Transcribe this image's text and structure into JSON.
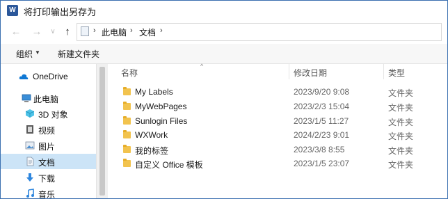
{
  "window": {
    "title": "将打印输出另存为",
    "app_icon": "word-app-icon"
  },
  "nav": {
    "back_icon": "back-arrow-icon",
    "forward_icon": "forward-arrow-icon",
    "recent_icon": "chevron-down-icon",
    "up_icon": "up-arrow-icon",
    "breadcrumb": [
      "此电脑",
      "文档"
    ],
    "breadcrumb_sep": "›"
  },
  "toolbar": {
    "organize_label": "组织",
    "new_folder_label": "新建文件夹"
  },
  "sidebar": {
    "items": [
      {
        "label": "OneDrive",
        "icon": "cloud-icon"
      },
      {
        "label": "此电脑",
        "icon": "computer-icon"
      },
      {
        "label": "3D 对象",
        "icon": "cube-icon"
      },
      {
        "label": "视频",
        "icon": "video-icon"
      },
      {
        "label": "图片",
        "icon": "picture-icon"
      },
      {
        "label": "文档",
        "icon": "document-icon",
        "selected": true
      },
      {
        "label": "下载",
        "icon": "download-icon"
      },
      {
        "label": "音乐",
        "icon": "music-icon"
      }
    ]
  },
  "columns": {
    "name": "名称",
    "modified": "修改日期",
    "type": "类型"
  },
  "files": [
    {
      "name": "My Labels",
      "modified": "2023/9/20 9:08",
      "type": "文件夹"
    },
    {
      "name": "MyWebPages",
      "modified": "2023/2/3 15:04",
      "type": "文件夹"
    },
    {
      "name": "Sunlogin Files",
      "modified": "2023/1/5 11:27",
      "type": "文件夹"
    },
    {
      "name": "WXWork",
      "modified": "2024/2/23 9:01",
      "type": "文件夹"
    },
    {
      "name": "我的标签",
      "modified": "2023/3/8 8:55",
      "type": "文件夹"
    },
    {
      "name": "自定义 Office 模板",
      "modified": "2023/1/5 23:07",
      "type": "文件夹"
    }
  ],
  "colors": {
    "selection": "#cce4f7",
    "folder": "#f2c34e",
    "accent": "#2b579a"
  }
}
